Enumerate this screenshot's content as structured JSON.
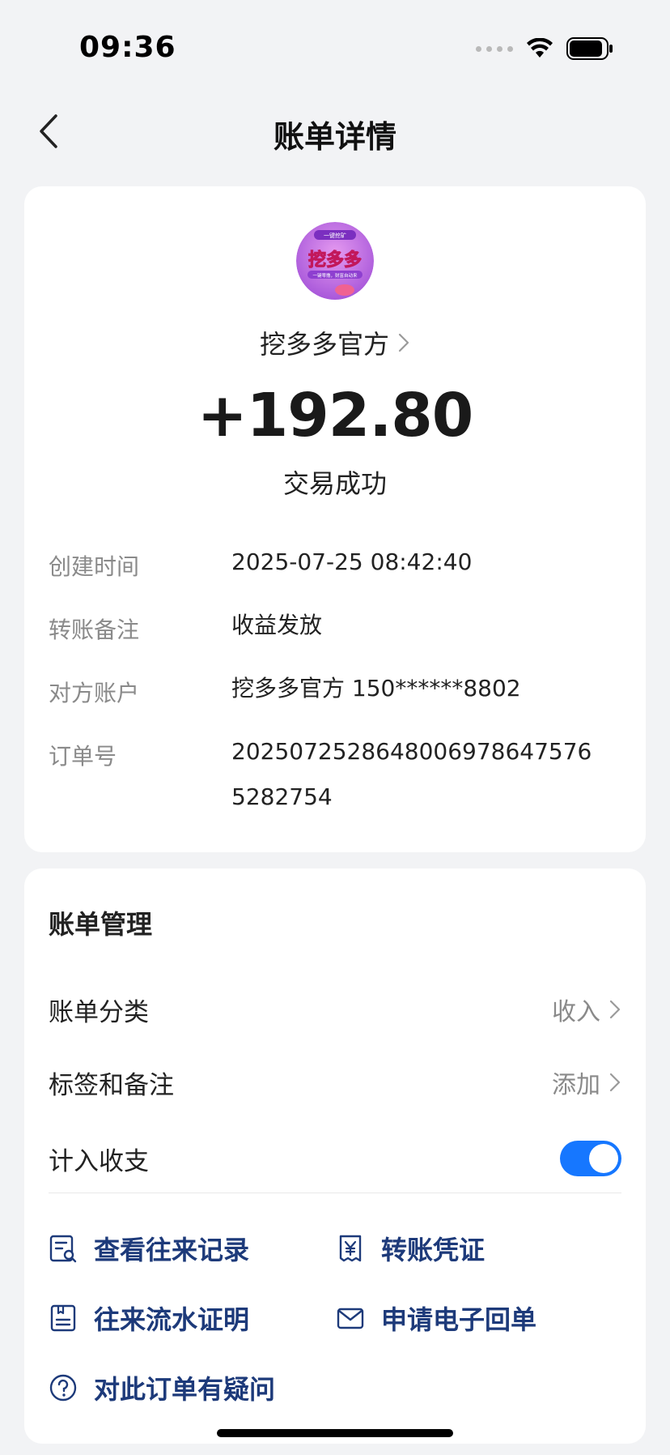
{
  "status_bar": {
    "time": "09:36"
  },
  "nav": {
    "title": "账单详情"
  },
  "merchant": {
    "name": "挖多多官方",
    "logo_text_top": "一键挖矿",
    "logo_text_main": "挖多多",
    "logo_text_sub": "一键零撸，财富自动来"
  },
  "transaction": {
    "amount": "+192.80",
    "status": "交易成功",
    "details": [
      {
        "label": "创建时间",
        "value": "2025-07-25 08:42:40"
      },
      {
        "label": "转账备注",
        "value": "收益发放"
      },
      {
        "label": "对方账户",
        "value": "挖多多官方 150******8802"
      },
      {
        "label": "订单号",
        "value": "20250725286480069786475765282754"
      }
    ]
  },
  "manage": {
    "title": "账单管理",
    "category_label": "账单分类",
    "category_value": "收入",
    "tags_label": "标签和备注",
    "tags_value": "添加",
    "count_label": "计入收支",
    "count_enabled": true
  },
  "actions": {
    "view_records": "查看往来记录",
    "transfer_voucher": "转账凭证",
    "flow_proof": "往来流水证明",
    "e_receipt": "申请电子回单",
    "question": "对此订单有疑问"
  },
  "colors": {
    "accent": "#1677ff",
    "action_text": "#1d3a7a",
    "background": "#f2f3f5"
  }
}
